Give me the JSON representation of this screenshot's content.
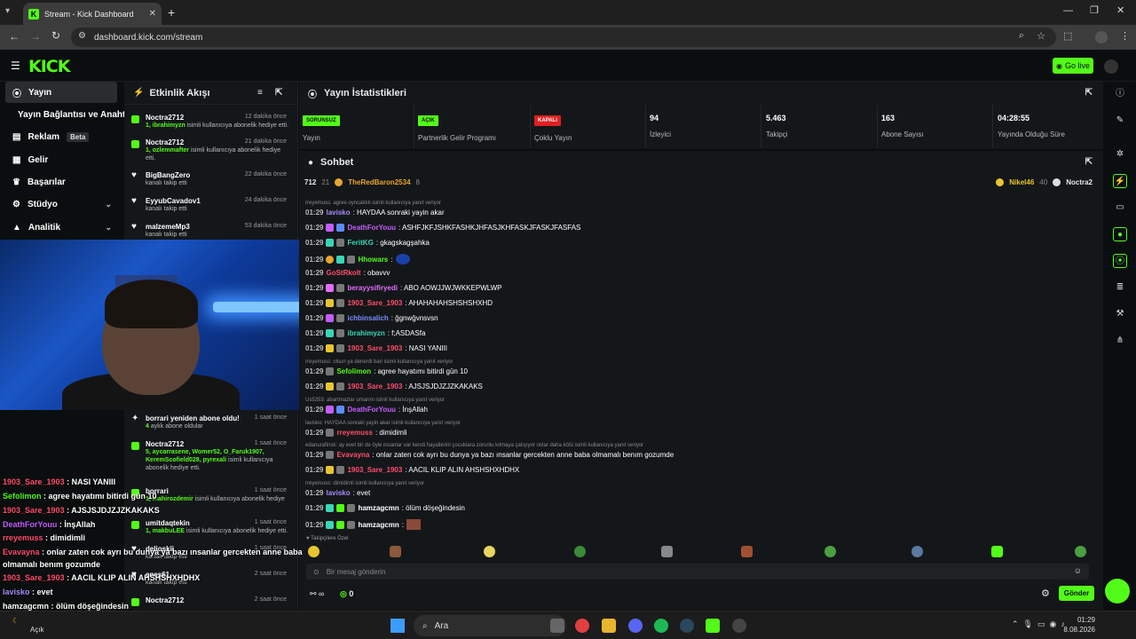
{
  "browser": {
    "tab_title": "Stream - Kick Dashboard",
    "url": "dashboard.kick.com/stream"
  },
  "header": {
    "logo": "KICK",
    "go_live": "Go live"
  },
  "nav": {
    "items": [
      {
        "label": "Yayın"
      },
      {
        "label": "Yayın Bağlantısı ve Anahtarı"
      },
      {
        "label": "Reklam",
        "badge": "Beta"
      },
      {
        "label": "Gelir"
      },
      {
        "label": "Başarılar"
      },
      {
        "label": "Stüdyo"
      },
      {
        "label": "Analitik"
      }
    ]
  },
  "feed": {
    "title": "Etkinlik Akışı",
    "items": [
      {
        "name": "Noctra2712",
        "time": "12 dakika önce",
        "sub_user": "1, ibrahimyzn",
        "sub_text": " isimli kullanıcıya abonelik hediye etti."
      },
      {
        "name": "Noctra2712",
        "time": "21 dakika önce",
        "sub_user": "1, ozlemmafter",
        "sub_text": " isimli kullanıcıya abonelik hediye etti."
      },
      {
        "name": "BigBangZero",
        "time": "22 dakika önce",
        "sub_text": "kanalı takip etti"
      },
      {
        "name": "EyyubCavadov1",
        "time": "24 dakika önce",
        "sub_text": "kanalı takip etti"
      },
      {
        "name": "malzemeMp3",
        "time": "53 dakika önce",
        "sub_text": "kanalı takip etti"
      },
      {
        "name": "borrari yeniden abone oldu!",
        "time": "1 saat önce",
        "sub_user": "4",
        "sub_text": " aylık abone oldular"
      },
      {
        "name": "Noctra2712",
        "time": "1 saat önce",
        "sub_user": "5, aycarrasene, Womer52, O_Faruk1907, KeremScofield028, pyrexali",
        "sub_text": " isimli kullanıcıya abonelik hediye etti."
      },
      {
        "name": "borrari",
        "time": "1 saat önce",
        "sub_user": "1, mahirozdemir",
        "sub_text": " isimli kullanıcıya abonelik hediye"
      },
      {
        "name": "umitdaqtekin",
        "time": "1 saat önce",
        "sub_user": "1, makbuLEE",
        "sub_text": " isimli kullanıcıya abonelik hediye etti."
      },
      {
        "name": "delioskii",
        "time": "1 saat önce",
        "sub_text": "kanalı takip etti"
      },
      {
        "name": "enes61",
        "time": "2 saat önce",
        "sub_text": "kanalı takip etti"
      },
      {
        "name": "Noctra2712",
        "time": "2 saat önce",
        "sub_text": ""
      }
    ]
  },
  "stats": {
    "title": "Yayın İstatistikleri",
    "items": [
      {
        "badge": "SORUNSUZ",
        "label": "Yayın"
      },
      {
        "badge": "AÇIK",
        "label": "Partnerlik Gelir Programı"
      },
      {
        "badge": "KAPALI",
        "label": "Çoklu Yayın"
      },
      {
        "value": "94",
        "label": "İzleyici"
      },
      {
        "value": "5.463",
        "label": "Takipçi"
      },
      {
        "value": "163",
        "label": "Abone Sayısı"
      },
      {
        "value": "04:28:55",
        "label": "Yayında Olduğu Süre"
      }
    ]
  },
  "chat": {
    "title": "Sohbet",
    "pinned": {
      "rank": "712",
      "count": "21",
      "user": "TheRedBaron2534",
      "user_count": "8",
      "user2": "Nikel46",
      "user2_count": "40",
      "user3": "Noctra2"
    },
    "messages": [
      {
        "time": "01:29",
        "user": "lavisko",
        "color": "#a78bfa",
        "text": ": HAYDAA sonraki yayin akar",
        "reply": "rreyemuss: agree oyncaktık isimli kullanıcıya yanıt veriyor"
      },
      {
        "time": "01:29",
        "user": "DeathForYouu",
        "color": "#c45cff",
        "text": ": ASHFJKFJSHKFASHKJHFASJKHFASKJFASKJFASFAS"
      },
      {
        "time": "01:29",
        "user": "FeritKG",
        "color": "#38d6b8",
        "text": ": gkagskagşahka"
      },
      {
        "time": "01:29",
        "user": "Hhowars",
        "color": "#53fc18",
        "text": ":"
      },
      {
        "time": "01:29",
        "user": "GoStRkolt",
        "color": "#ff4d6d",
        "text": ": obavvv"
      },
      {
        "time": "01:29",
        "user": "berayysifiryedi",
        "color": "#e26cff",
        "text": ": ABO AOWJJWJWKKEPWLWP"
      },
      {
        "time": "01:29",
        "user": "1903_Sare_1903",
        "color": "#ff4d6d",
        "text": ": AHAHAHAHSHSHSHXHD"
      },
      {
        "time": "01:29",
        "user": "ichbinsalich",
        "color": "#7c8cff",
        "text": ": ğgnwğvnsvsn"
      },
      {
        "time": "01:29",
        "user": "ibrahimyzn",
        "color": "#38d6b8",
        "text": ": f;ASDASfa"
      },
      {
        "time": "01:29",
        "user": "1903_Sare_1903",
        "color": "#ff4d6d",
        "text": ": NASI YANIII"
      },
      {
        "time": "01:29",
        "user": "Sefolimon",
        "color": "#53fc18",
        "text": ": agree hayatımı bitirdi gün 10",
        "reply": "rreyemuss: olsun ya denerdi bari isimli kullanıcıya yanıt veriyor"
      },
      {
        "time": "01:29",
        "user": "1903_Sare_1903",
        "color": "#ff4d6d",
        "text": ": AJSJSJDJZJZKAKAKS"
      },
      {
        "time": "01:29",
        "user": "DeathForYouu",
        "color": "#c45cff",
        "text": ": İnşAllah",
        "reply": "Us5353: abartmazlar umarım isimli kullanıcıya yanıt veriyor"
      },
      {
        "time": "01:29",
        "user": "rreyemuss",
        "color": "#ff4d6d",
        "text": ": dimidimli",
        "reply": "lavisko: HAYDAA sonraki yayin akar isimli kullanıcıya yanıt veriyor"
      },
      {
        "time": "01:29",
        "user": "Evavayna",
        "color": "#ff4d6d",
        "text": ": onlar zaten cok ayrı bu dunya ya bazı ınsanlar gercekten anne baba olmamalı benım gozumde",
        "reply": "edanurafinsk: ay evet bir de öyle insanlar var kendi hayallerini çocuklara zorunlu kılmaya çalışıyor onlar daha kötü isimli kullanıcıya yanıt veriyor"
      },
      {
        "time": "01:29",
        "user": "1903_Sare_1903",
        "color": "#ff4d6d",
        "text": ": AACIL KLIP ALIN AHSHSHXHDHX"
      },
      {
        "time": "01:29",
        "user": "lavisko",
        "color": "#a78bfa",
        "text": ": evet",
        "reply": "rreyemuss: dimidimli isimli kullanıcıya yanıt veriyor"
      },
      {
        "time": "01:29",
        "user": "hamzagcmn",
        "color": "#ffffff",
        "text": ": ölüm döşeğindesin"
      },
      {
        "time": "01:29",
        "user": "hamzagcmn",
        "color": "#ffffff",
        "text": ":"
      }
    ],
    "emote_label": "Takipçilere Özel",
    "input_placeholder": "Bir mesaj gönderin",
    "points": "0",
    "send": "Gönder"
  },
  "overlay": [
    {
      "user": "1903_Sare_1903",
      "color": "#ff4d6d",
      "text": " : NASI YANIII"
    },
    {
      "user": "Sefolimon",
      "color": "#53fc18",
      "text": " : agree hayatımı bitirdi gün 10"
    },
    {
      "user": "1903_Sare_1903",
      "color": "#ff4d6d",
      "text": " : AJSJSJDJZJZKAKAKS"
    },
    {
      "user": "DeathForYouu",
      "color": "#c45cff",
      "text": " : İnşAllah"
    },
    {
      "user": "rreyemuss",
      "color": "#ff4d6d",
      "text": " : dimidimli"
    },
    {
      "user": "Evavayna",
      "color": "#ff4d6d",
      "text": " : onlar zaten cok ayrı bu dunya ya bazı ınsanlar gercekten anne baba"
    },
    {
      "user": "",
      "color": "#ffffff",
      "text": "olmamalı benım gozumde"
    },
    {
      "user": "1903_Sare_1903",
      "color": "#ff4d6d",
      "text": " : AACIL KLIP ALIN AHSHSHXHDHX"
    },
    {
      "user": "lavisko",
      "color": "#a78bfa",
      "text": " : evet"
    },
    {
      "user": "hamzagcmn",
      "color": "#ffffff",
      "text": " : ölüm döşeğindesin"
    },
    {
      "user": "hamzagcmn",
      "color": "#ffffff",
      "text": " :"
    }
  ],
  "taskbar": {
    "weather": "Açık",
    "search": "Ara",
    "time": "01:29",
    "date": "8.08.2026"
  },
  "colors": {
    "accent": "#53fc18",
    "panel": "#141719",
    "background": "#0b0e0f"
  }
}
